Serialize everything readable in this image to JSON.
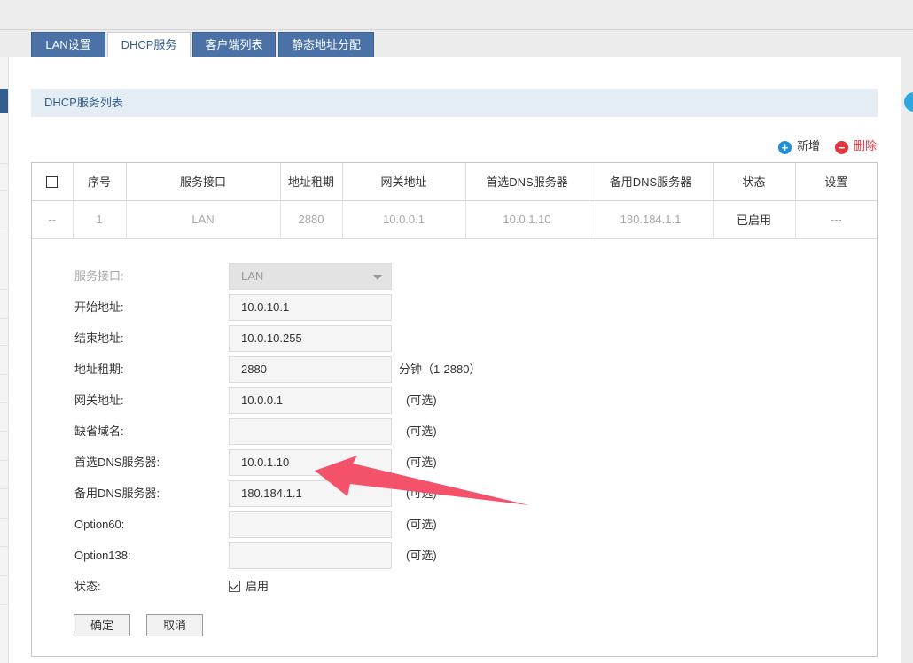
{
  "tabs": [
    {
      "label": "LAN设置"
    },
    {
      "label": "DHCP服务"
    },
    {
      "label": "客户端列表"
    },
    {
      "label": "静态地址分配"
    }
  ],
  "section": {
    "title": "DHCP服务列表"
  },
  "toolbar": {
    "add_label": "新增",
    "delete_label": "删除",
    "add_icon": "+",
    "delete_icon": "−"
  },
  "table": {
    "headers": [
      "序号",
      "服务接口",
      "地址租期",
      "网关地址",
      "首选DNS服务器",
      "备用DNS服务器",
      "状态",
      "设置"
    ],
    "rows": [
      {
        "check": "--",
        "index": "1",
        "interface": "LAN",
        "lease": "2880",
        "gateway": "10.0.0.1",
        "dns1": "10.0.1.10",
        "dns2": "180.184.1.1",
        "status": "已启用",
        "settings": "---"
      }
    ]
  },
  "form": {
    "interface_label": "服务接口:",
    "interface_value": "LAN",
    "start_label": "开始地址:",
    "start_value": "10.0.10.1",
    "end_label": "结束地址:",
    "end_value": "10.0.10.255",
    "lease_label": "地址租期:",
    "lease_value": "2880",
    "lease_hint": "分钟（1-2880）",
    "gateway_label": "网关地址:",
    "gateway_value": "10.0.0.1",
    "domain_label": "缺省域名:",
    "domain_value": "",
    "dns1_label": "首选DNS服务器:",
    "dns1_value": "10.0.1.10",
    "dns2_label": "备用DNS服务器:",
    "dns2_value": "180.184.1.1",
    "opt60_label": "Option60:",
    "opt60_value": "",
    "opt138_label": "Option138:",
    "opt138_value": "",
    "optional_hint": "(可选)",
    "status_label": "状态:",
    "status_check_label": "启用",
    "ok_label": "确定",
    "cancel_label": "取消"
  },
  "colors": {
    "accent": "#4a72a6",
    "add": "#1e90d6",
    "delete": "#e0343f",
    "arrow": "#f4526b"
  }
}
